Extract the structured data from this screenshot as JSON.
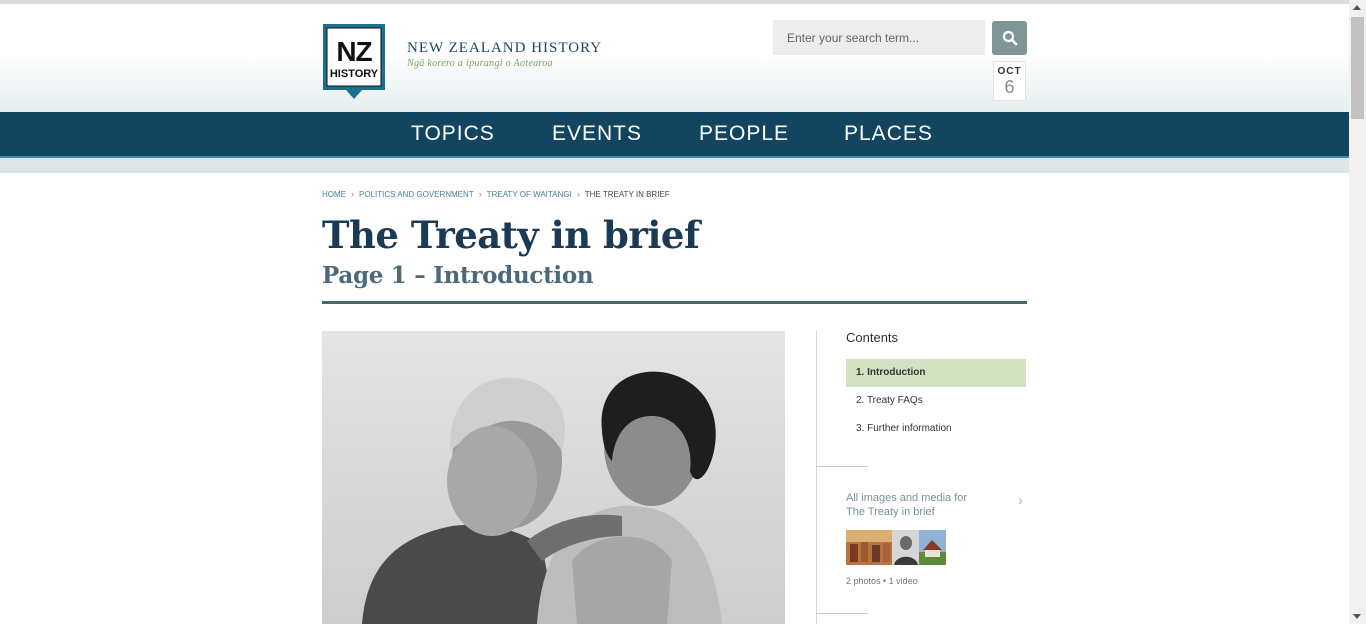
{
  "site": {
    "logo_top": "NZ",
    "logo_bottom": "HISTORY",
    "title": "NEW ZEALAND HISTORY",
    "subtitle": "Ngā korero a ipurangi o Aotearoa"
  },
  "search": {
    "placeholder": "Enter your search term...",
    "button_icon": "search-icon"
  },
  "date": {
    "month": "OCT",
    "day": "6"
  },
  "nav": {
    "items": [
      "TOPICS",
      "EVENTS",
      "PEOPLE",
      "PLACES"
    ]
  },
  "breadcrumb": {
    "items": [
      "HOME",
      "POLITICS AND GOVERNMENT",
      "TREATY OF WAITANGI",
      "THE TREATY IN BRIEF"
    ],
    "separator_icon": "chevron-right-icon"
  },
  "page": {
    "title": "The Treaty in brief",
    "subtitle": "Page 1 – Introduction"
  },
  "contents": {
    "heading": "Contents",
    "items": [
      {
        "label": "1. Introduction",
        "active": true
      },
      {
        "label": "2. Treaty FAQs",
        "active": false
      },
      {
        "label": "3. Further information",
        "active": false
      }
    ]
  },
  "media": {
    "link_line1": "All images and media for",
    "link_line2": "The Treaty in brief",
    "count": "2 photos • 1 video",
    "chevron_icon": "chevron-right-icon"
  },
  "colors": {
    "nav_bg": "#144560",
    "title": "#1b3a55",
    "accent_green": "#d4e2c4",
    "rule": "#3f6d66"
  }
}
